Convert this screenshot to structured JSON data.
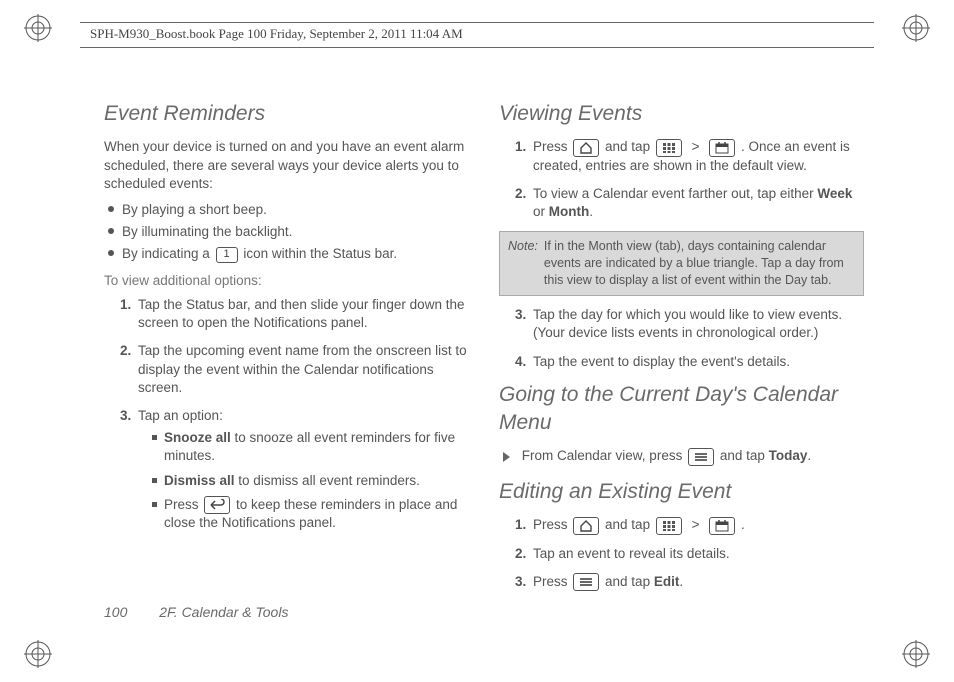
{
  "header": {
    "running_head": "SPH-M930_Boost.book  Page 100  Friday, September 2, 2011  11:04 AM"
  },
  "left": {
    "h_event_reminders": "Event Reminders",
    "intro": "When your device is turned on and you have an event alarm scheduled, there are several ways your device alerts you to scheduled events:",
    "b1": "By playing a short beep.",
    "b2": "By illuminating the backlight.",
    "b3a": "By indicating a ",
    "b3b": " icon within the Status bar.",
    "to_view": "To view additional options:",
    "n1": "Tap the Status bar, and then slide your finger down the screen to open the Notifications panel.",
    "n2": "Tap the upcoming event name from the onscreen list to display the event within the Calendar notifications screen.",
    "n3": "Tap an option:",
    "s1_bold": "Snooze all",
    "s1_rest": " to snooze all event reminders for five minutes.",
    "s2_bold": "Dismiss all",
    "s2_rest": " to dismiss all event reminders.",
    "s3_a": "Press ",
    "s3_b": " to keep these reminders in place and close the Notifications panel."
  },
  "right": {
    "h_viewing": "Viewing Events",
    "v1a": "Press ",
    "v1b": " and tap ",
    "v1c": " > ",
    "v1d": ". Once an event is created, entries are shown in the default view.",
    "v2a": "To view a Calendar event farther out, tap either ",
    "v2_week": "Week",
    "v2_or": " or ",
    "v2_month": "Month",
    "v2_end": ".",
    "note_label": "Note:",
    "note_body": "If in the Month view (tab), days containing calendar events are indicated by a blue triangle. Tap a day from this view to display a list of event within the Day tab.",
    "v3": "Tap the day for which you would like to view events. (Your device lists events in chronological order.)",
    "v4": "Tap the event to display the event's details.",
    "h_going": "Going to the Current Day's Calendar Menu",
    "g1a": "From Calendar view, press ",
    "g1b": " and tap ",
    "g1_today": "Today",
    "g1_end": ".",
    "h_editing": "Editing an Existing Event",
    "e1a": "Press ",
    "e1b": " and tap ",
    "e1c": " > ",
    "e1d": ".",
    "e2": "Tap an event to reveal its details.",
    "e3a": "Press ",
    "e3b": " and tap ",
    "e3_edit": "Edit",
    "e3_end": "."
  },
  "footer": {
    "page_number": "100",
    "section": "2F. Calendar & Tools"
  },
  "icons": {
    "cal_one": "1",
    "back_arrow": "↩",
    "home": "⌂",
    "grid": "▦",
    "calendar": "📅",
    "menu": "≡"
  }
}
